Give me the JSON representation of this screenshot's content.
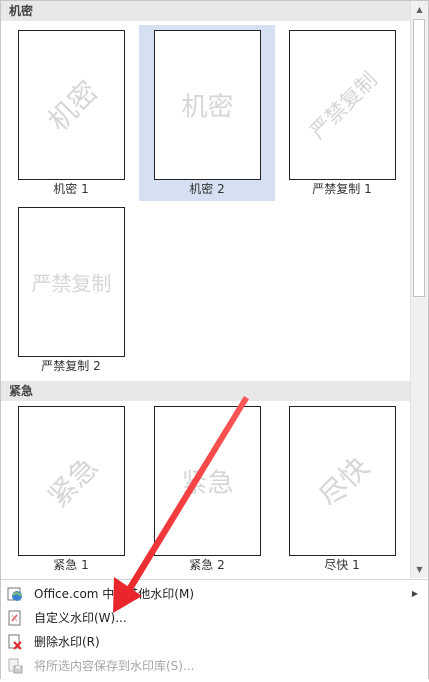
{
  "sections": [
    {
      "title": "机密",
      "tiles": [
        {
          "label": "机密 1",
          "watermark": "机密",
          "style": "diagonal"
        },
        {
          "label": "机密 2",
          "watermark": "机密",
          "style": "horizontal",
          "selected": true
        },
        {
          "label": "严禁复制 1",
          "watermark": "严禁复制",
          "style": "diagonal"
        },
        {
          "label": "严禁复制 2",
          "watermark": "严禁复制",
          "style": "horizontal"
        }
      ]
    },
    {
      "title": "紧急",
      "tiles": [
        {
          "label": "紧急 1",
          "watermark": "紧急",
          "style": "diagonal"
        },
        {
          "label": "紧急 2",
          "watermark": "紧急",
          "style": "horizontal"
        },
        {
          "label": "尽快 1",
          "watermark": "尽快",
          "style": "diagonal"
        }
      ]
    }
  ],
  "menu": {
    "more_watermarks": "Office.com 中的其他水印(M)",
    "custom_watermark": "自定义水印(W)...",
    "remove_watermark": "删除水印(R)",
    "save_selection": "将所选内容保存到水印库(S)..."
  },
  "colors": {
    "selected_tile": "#d5e1f2",
    "section_header": "#e8e8e8",
    "annotation_arrow": "#e8262b"
  }
}
